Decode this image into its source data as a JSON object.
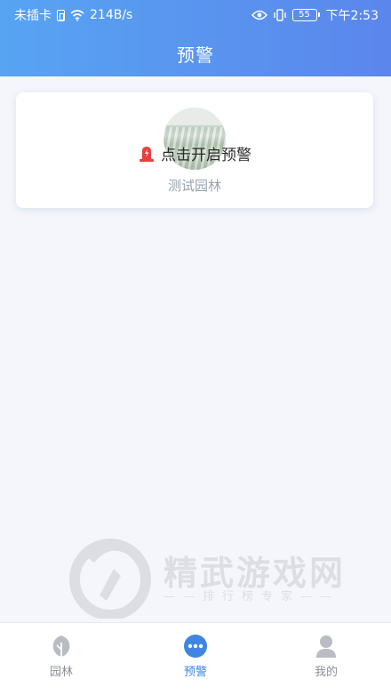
{
  "status_bar": {
    "carrier": "未插卡",
    "network_speed": "214B/s",
    "battery_level": "55",
    "time": "下午2:53"
  },
  "header": {
    "title": "预警"
  },
  "garden_card": {
    "alert_label": "点击开启预警",
    "garden_name": "测试园林"
  },
  "watermark": {
    "title": "精武游戏网",
    "subtitle": "——排行榜专家——"
  },
  "bottom_nav": {
    "items": [
      {
        "label": "园林",
        "icon": "leaf-icon",
        "active": false
      },
      {
        "label": "预警",
        "icon": "more-dots-icon",
        "active": true
      },
      {
        "label": "我的",
        "icon": "person-icon",
        "active": false
      }
    ]
  },
  "colors": {
    "header_gradient_start": "#57a4f3",
    "header_gradient_end": "#5b86ec",
    "accent": "#3e86e2",
    "alarm": "#e8413c",
    "background": "#f4f6fb"
  }
}
